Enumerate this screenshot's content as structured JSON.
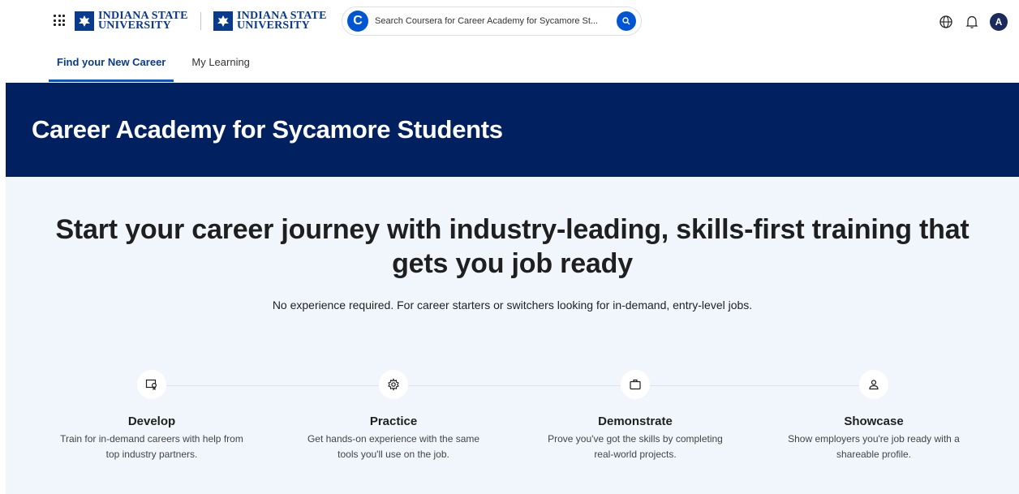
{
  "header": {
    "logo_primary": [
      "INDIANA STATE",
      "UNIVERSITY"
    ],
    "logo_secondary": [
      "INDIANA STATE",
      "UNIVERSITY"
    ],
    "search_placeholder": "Search Coursera for Career Academy for Sycamore St...",
    "avatar_initial": "A",
    "brand_color": "#0056d2"
  },
  "tabs": [
    {
      "label": "Find your New Career",
      "active": true
    },
    {
      "label": "My Learning",
      "active": false
    }
  ],
  "banner": {
    "title": "Career Academy for Sycamore Students",
    "background": "#002060"
  },
  "main": {
    "headline_line1": "Start your career journey with industry-leading, skills-first training that",
    "headline_line2": "gets you job ready",
    "subline": "No experience required. For career starters or switchers looking for in-demand, entry-level jobs.",
    "steps": [
      {
        "icon": "certificate-icon",
        "title": "Develop",
        "desc_line1": "Train for in-demand careers with help from",
        "desc_line2": "top industry partners."
      },
      {
        "icon": "gear-icon",
        "title": "Practice",
        "desc_line1": "Get hands-on experience with the same",
        "desc_line2": "tools you'll use on the job."
      },
      {
        "icon": "briefcase-icon",
        "title": "Demonstrate",
        "desc_line1": "Prove you've got the skills by completing",
        "desc_line2": "real-world projects."
      },
      {
        "icon": "person-icon",
        "title": "Showcase",
        "desc_line1": "Show employers you're job ready with a",
        "desc_line2": "shareable profile."
      }
    ]
  }
}
